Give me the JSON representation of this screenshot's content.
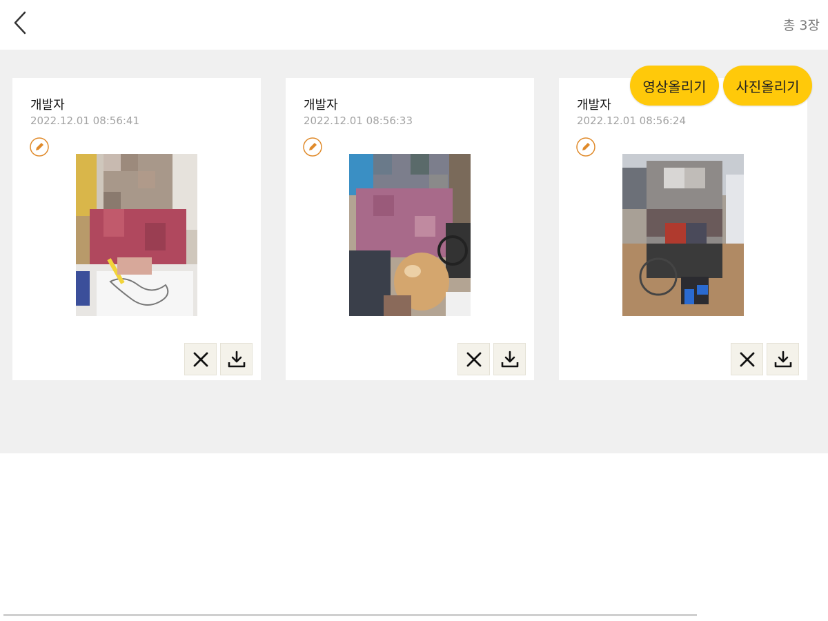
{
  "header": {
    "back_icon": "chevron-left-icon",
    "total_label": "총 3장"
  },
  "actions": {
    "upload_video": "영상올리기",
    "upload_photo": "사진올리기",
    "accent_color": "#ffc90a"
  },
  "cards": [
    {
      "author": "개발자",
      "date": "2022.12.01 08:56:41",
      "photo": "coloring-activity-photo"
    },
    {
      "author": "개발자",
      "date": "2022.12.01 08:56:33",
      "photo": "balloon-activity-photo"
    },
    {
      "author": "개발자",
      "date": "2022.12.01 08:56:24",
      "photo": "wheelchair-hall-photo"
    }
  ],
  "card_icons": {
    "edit": "pencil-icon",
    "delete": "close-icon",
    "download": "download-icon"
  }
}
